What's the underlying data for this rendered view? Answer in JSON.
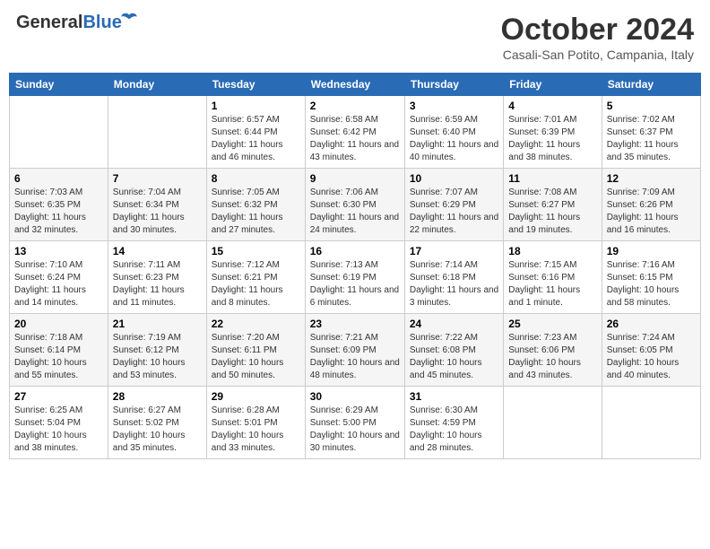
{
  "header": {
    "logo_general": "General",
    "logo_blue": "Blue",
    "month_title": "October 2024",
    "location": "Casali-San Potito, Campania, Italy"
  },
  "days_of_week": [
    "Sunday",
    "Monday",
    "Tuesday",
    "Wednesday",
    "Thursday",
    "Friday",
    "Saturday"
  ],
  "weeks": [
    [
      {
        "day": "",
        "sunrise": "",
        "sunset": "",
        "daylight": ""
      },
      {
        "day": "",
        "sunrise": "",
        "sunset": "",
        "daylight": ""
      },
      {
        "day": "1",
        "sunrise": "Sunrise: 6:57 AM",
        "sunset": "Sunset: 6:44 PM",
        "daylight": "Daylight: 11 hours and 46 minutes."
      },
      {
        "day": "2",
        "sunrise": "Sunrise: 6:58 AM",
        "sunset": "Sunset: 6:42 PM",
        "daylight": "Daylight: 11 hours and 43 minutes."
      },
      {
        "day": "3",
        "sunrise": "Sunrise: 6:59 AM",
        "sunset": "Sunset: 6:40 PM",
        "daylight": "Daylight: 11 hours and 40 minutes."
      },
      {
        "day": "4",
        "sunrise": "Sunrise: 7:01 AM",
        "sunset": "Sunset: 6:39 PM",
        "daylight": "Daylight: 11 hours and 38 minutes."
      },
      {
        "day": "5",
        "sunrise": "Sunrise: 7:02 AM",
        "sunset": "Sunset: 6:37 PM",
        "daylight": "Daylight: 11 hours and 35 minutes."
      }
    ],
    [
      {
        "day": "6",
        "sunrise": "Sunrise: 7:03 AM",
        "sunset": "Sunset: 6:35 PM",
        "daylight": "Daylight: 11 hours and 32 minutes."
      },
      {
        "day": "7",
        "sunrise": "Sunrise: 7:04 AM",
        "sunset": "Sunset: 6:34 PM",
        "daylight": "Daylight: 11 hours and 30 minutes."
      },
      {
        "day": "8",
        "sunrise": "Sunrise: 7:05 AM",
        "sunset": "Sunset: 6:32 PM",
        "daylight": "Daylight: 11 hours and 27 minutes."
      },
      {
        "day": "9",
        "sunrise": "Sunrise: 7:06 AM",
        "sunset": "Sunset: 6:30 PM",
        "daylight": "Daylight: 11 hours and 24 minutes."
      },
      {
        "day": "10",
        "sunrise": "Sunrise: 7:07 AM",
        "sunset": "Sunset: 6:29 PM",
        "daylight": "Daylight: 11 hours and 22 minutes."
      },
      {
        "day": "11",
        "sunrise": "Sunrise: 7:08 AM",
        "sunset": "Sunset: 6:27 PM",
        "daylight": "Daylight: 11 hours and 19 minutes."
      },
      {
        "day": "12",
        "sunrise": "Sunrise: 7:09 AM",
        "sunset": "Sunset: 6:26 PM",
        "daylight": "Daylight: 11 hours and 16 minutes."
      }
    ],
    [
      {
        "day": "13",
        "sunrise": "Sunrise: 7:10 AM",
        "sunset": "Sunset: 6:24 PM",
        "daylight": "Daylight: 11 hours and 14 minutes."
      },
      {
        "day": "14",
        "sunrise": "Sunrise: 7:11 AM",
        "sunset": "Sunset: 6:23 PM",
        "daylight": "Daylight: 11 hours and 11 minutes."
      },
      {
        "day": "15",
        "sunrise": "Sunrise: 7:12 AM",
        "sunset": "Sunset: 6:21 PM",
        "daylight": "Daylight: 11 hours and 8 minutes."
      },
      {
        "day": "16",
        "sunrise": "Sunrise: 7:13 AM",
        "sunset": "Sunset: 6:19 PM",
        "daylight": "Daylight: 11 hours and 6 minutes."
      },
      {
        "day": "17",
        "sunrise": "Sunrise: 7:14 AM",
        "sunset": "Sunset: 6:18 PM",
        "daylight": "Daylight: 11 hours and 3 minutes."
      },
      {
        "day": "18",
        "sunrise": "Sunrise: 7:15 AM",
        "sunset": "Sunset: 6:16 PM",
        "daylight": "Daylight: 11 hours and 1 minute."
      },
      {
        "day": "19",
        "sunrise": "Sunrise: 7:16 AM",
        "sunset": "Sunset: 6:15 PM",
        "daylight": "Daylight: 10 hours and 58 minutes."
      }
    ],
    [
      {
        "day": "20",
        "sunrise": "Sunrise: 7:18 AM",
        "sunset": "Sunset: 6:14 PM",
        "daylight": "Daylight: 10 hours and 55 minutes."
      },
      {
        "day": "21",
        "sunrise": "Sunrise: 7:19 AM",
        "sunset": "Sunset: 6:12 PM",
        "daylight": "Daylight: 10 hours and 53 minutes."
      },
      {
        "day": "22",
        "sunrise": "Sunrise: 7:20 AM",
        "sunset": "Sunset: 6:11 PM",
        "daylight": "Daylight: 10 hours and 50 minutes."
      },
      {
        "day": "23",
        "sunrise": "Sunrise: 7:21 AM",
        "sunset": "Sunset: 6:09 PM",
        "daylight": "Daylight: 10 hours and 48 minutes."
      },
      {
        "day": "24",
        "sunrise": "Sunrise: 7:22 AM",
        "sunset": "Sunset: 6:08 PM",
        "daylight": "Daylight: 10 hours and 45 minutes."
      },
      {
        "day": "25",
        "sunrise": "Sunrise: 7:23 AM",
        "sunset": "Sunset: 6:06 PM",
        "daylight": "Daylight: 10 hours and 43 minutes."
      },
      {
        "day": "26",
        "sunrise": "Sunrise: 7:24 AM",
        "sunset": "Sunset: 6:05 PM",
        "daylight": "Daylight: 10 hours and 40 minutes."
      }
    ],
    [
      {
        "day": "27",
        "sunrise": "Sunrise: 6:25 AM",
        "sunset": "Sunset: 5:04 PM",
        "daylight": "Daylight: 10 hours and 38 minutes."
      },
      {
        "day": "28",
        "sunrise": "Sunrise: 6:27 AM",
        "sunset": "Sunset: 5:02 PM",
        "daylight": "Daylight: 10 hours and 35 minutes."
      },
      {
        "day": "29",
        "sunrise": "Sunrise: 6:28 AM",
        "sunset": "Sunset: 5:01 PM",
        "daylight": "Daylight: 10 hours and 33 minutes."
      },
      {
        "day": "30",
        "sunrise": "Sunrise: 6:29 AM",
        "sunset": "Sunset: 5:00 PM",
        "daylight": "Daylight: 10 hours and 30 minutes."
      },
      {
        "day": "31",
        "sunrise": "Sunrise: 6:30 AM",
        "sunset": "Sunset: 4:59 PM",
        "daylight": "Daylight: 10 hours and 28 minutes."
      },
      {
        "day": "",
        "sunrise": "",
        "sunset": "",
        "daylight": ""
      },
      {
        "day": "",
        "sunrise": "",
        "sunset": "",
        "daylight": ""
      }
    ]
  ]
}
